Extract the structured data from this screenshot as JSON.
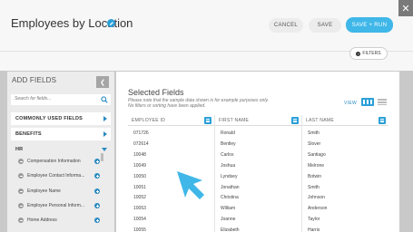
{
  "header": {
    "title": "Employees by Location",
    "cancel_label": "CANCEL",
    "save_label": "SAVE",
    "save_run_label": "SAVE + RUN",
    "close_label": "✕",
    "filters_label": "FILTERS",
    "filters_icon": "+"
  },
  "sidebar": {
    "title": "ADD FIELDS",
    "collapse_glyph": "❮",
    "search_placeholder": "Search for fields...",
    "sections": [
      {
        "label": "COMMONLY USED FIELDS",
        "expanded": false
      },
      {
        "label": "BENEFITS",
        "expanded": false
      },
      {
        "label": "HR",
        "expanded": true
      }
    ],
    "hr_fields": [
      "Compensation Information",
      "Employee Contact Informa...",
      "Employee Name",
      "Employee Personal Inform...",
      "Home Address"
    ]
  },
  "main": {
    "title": "Selected Fields",
    "note_line1": "Please note that the sample data shown is for example purposes only.",
    "note_line2": "No filters or sorting have been applied.",
    "view_label": "VIEW",
    "columns": [
      {
        "header": "EMPLOYEE ID",
        "values": [
          "071726",
          "072614",
          "10048",
          "10049",
          "10050",
          "10051",
          "10052",
          "10053",
          "10054",
          "10055"
        ]
      },
      {
        "header": "FIRST NAME",
        "values": [
          "Ronald",
          "Bentley",
          "Carlos",
          "Joshua",
          "Lyndsey",
          "Jonathan",
          "Christina",
          "William",
          "Joanne",
          "Elizabeth"
        ]
      },
      {
        "header": "LAST NAME",
        "values": [
          "Smith",
          "Slover",
          "Santiago",
          "Melrone",
          "Botwin",
          "Smith",
          "Johnson",
          "Anderson",
          "Taylor",
          "Harris"
        ]
      }
    ]
  },
  "colors": {
    "accent": "#2aa0d8",
    "save_run": "#3fb7e8",
    "caret": "#2a8bc1"
  }
}
